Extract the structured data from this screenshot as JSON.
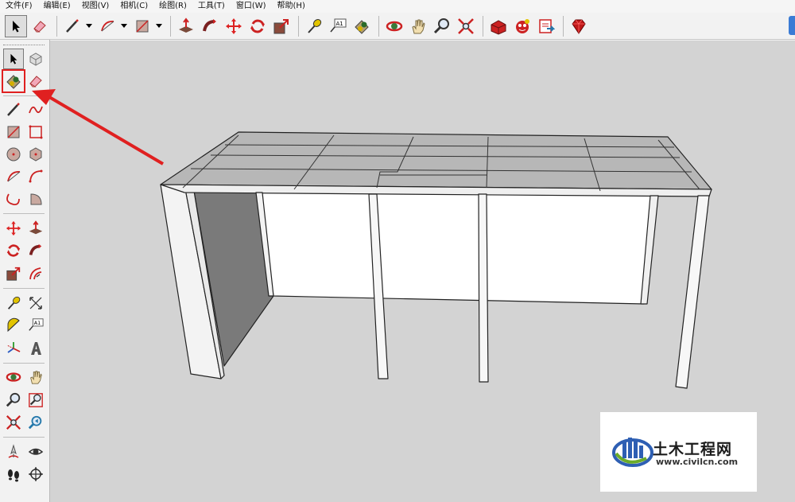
{
  "menubar": {
    "items": [
      "文件(F)",
      "编辑(E)",
      "视图(V)",
      "相机(C)",
      "绘图(R)",
      "工具(T)",
      "窗口(W)",
      "帮助(H)"
    ]
  },
  "toolbar": {
    "buttons": [
      "select-icon",
      "eraser-icon",
      "line-icon",
      "arc-icon",
      "rectangle-icon",
      "push-pull-icon",
      "follow-me-icon",
      "move-icon",
      "rotate-icon",
      "scale-icon",
      "tape-measure-icon",
      "text-icon",
      "paint-bucket-icon",
      "orbit-icon",
      "pan-icon",
      "zoom-icon",
      "zoom-extents-icon",
      "warehouse-icon",
      "extension-icon",
      "share-icon",
      "ruby-icon"
    ],
    "text_label": "A1"
  },
  "palette": {
    "buttons": [
      "select-icon",
      "component-icon",
      "paint-bucket-icon",
      "eraser-icon",
      "line-icon",
      "freehand-icon",
      "rectangle-icon",
      "rotated-rectangle-icon",
      "circle-icon",
      "polygon-icon",
      "arc-icon",
      "two-point-arc-icon",
      "three-point-arc-icon",
      "pie-icon",
      "move-icon",
      "push-pull-icon",
      "rotate-icon",
      "follow-me-icon",
      "scale-icon",
      "offset-icon",
      "tape-measure-icon",
      "dimension-icon",
      "protractor-icon",
      "text-icon",
      "axes-icon",
      "3d-text-icon",
      "orbit-icon",
      "pan-icon",
      "zoom-icon",
      "zoom-window-icon",
      "zoom-extents-icon",
      "previous-view-icon",
      "position-camera-icon",
      "look-around-icon",
      "walk-icon",
      "section-plane-icon"
    ],
    "text_label": "A1",
    "highlighted": "paint-bucket-icon"
  },
  "watermark": {
    "title": "土木工程网",
    "url": "www.civilcn.com"
  },
  "colors": {
    "viewport_bg": "#d3d3d3",
    "highlight": "#e02020",
    "accent": "#3a7bd5"
  }
}
